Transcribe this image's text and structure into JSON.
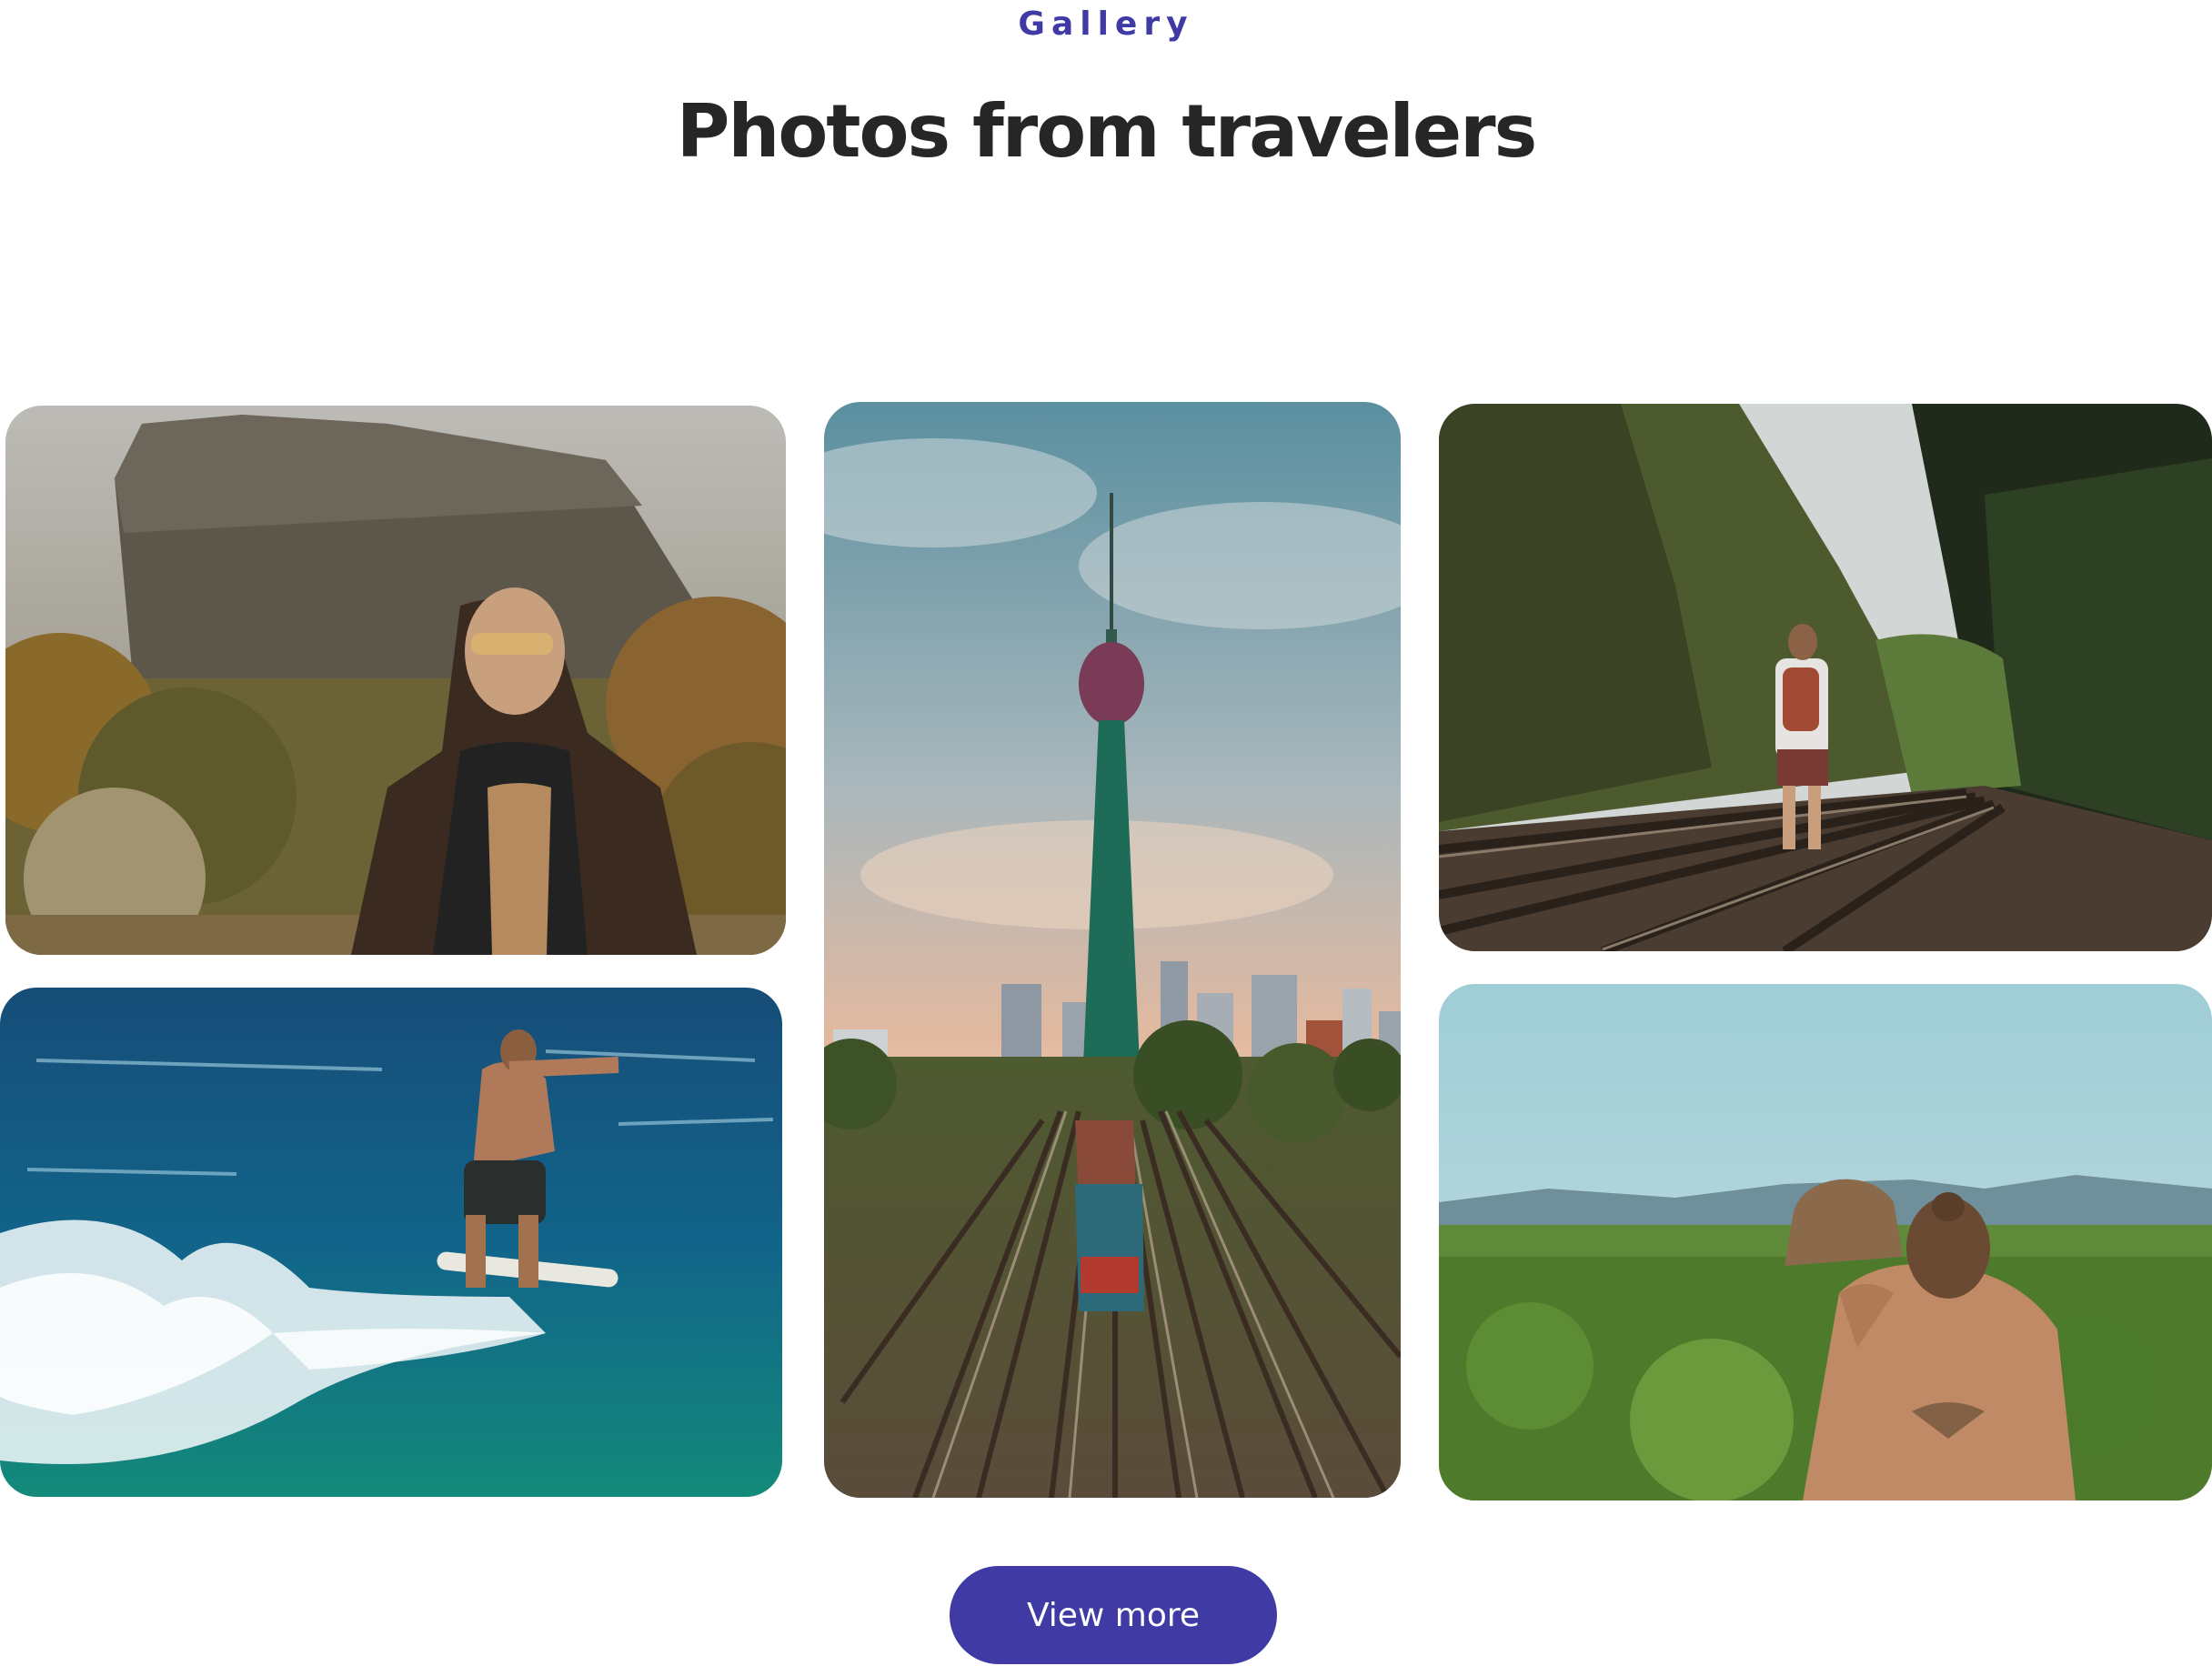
{
  "section": {
    "eyebrow": "Gallery",
    "title": "Photos from travelers"
  },
  "colors": {
    "accent": "#3f3aa4",
    "heading": "#262626",
    "background": "#ffffff"
  },
  "gallery": {
    "photos": [
      {
        "name": "rock-fortress-traveler-photo"
      },
      {
        "name": "city-tower-railway-photo"
      },
      {
        "name": "railway-hiker-photo"
      },
      {
        "name": "surfer-wave-photo"
      },
      {
        "name": "valley-viewpoint-photo"
      }
    ]
  },
  "actions": {
    "view_more_label": "View more"
  }
}
